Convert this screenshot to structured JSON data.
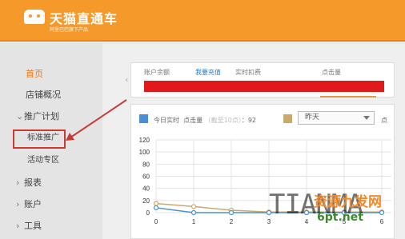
{
  "header": {
    "brand": "天猫直通车",
    "tagline": "阿里巴巴旗下产品"
  },
  "sidebar": {
    "items": [
      {
        "label": "首页",
        "state": "active"
      },
      {
        "label": "店铺概况"
      },
      {
        "label": "推广计划",
        "group": true
      },
      {
        "label": "标准推广",
        "highlighted": true
      },
      {
        "label": "活动专区"
      },
      {
        "label": "报表",
        "group": true
      },
      {
        "label": "账户",
        "group": true
      },
      {
        "label": "工具",
        "group": true
      }
    ]
  },
  "summary": {
    "balance_label": "账户余额",
    "recharge_link": "我要充值",
    "realtime_label": "实时扣费",
    "clicks_label": "点击量"
  },
  "chart_controls": {
    "today_label": "今日实时",
    "clicks_label": "点击量",
    "clicks_note": "（截至10点）",
    "clicks_value": "92",
    "compare_select": "昨天",
    "compare_label": "点"
  },
  "colors": {
    "accent": "#f59a2a",
    "today_series": "#4a8fd4",
    "yesterday_series": "#c8aa6e",
    "highlight": "#c93a34"
  },
  "chart_data": {
    "type": "line",
    "x": [
      0,
      1,
      2,
      3,
      4,
      5,
      6
    ],
    "yticks": [
      0,
      20,
      40,
      60,
      80,
      100,
      120
    ],
    "ylim": [
      0,
      120
    ],
    "grid": true,
    "series": [
      {
        "values": [
          8,
          0,
          0,
          0,
          0,
          0,
          0
        ],
        "color": "#4a8fd4"
      },
      {
        "values": [
          15,
          10,
          4,
          1,
          1,
          1,
          1
        ],
        "color": "#c8aa6e"
      }
    ]
  },
  "watermark": {
    "brand": "TIANMA",
    "cn": "资源九发网",
    "url": "6pt.net"
  }
}
